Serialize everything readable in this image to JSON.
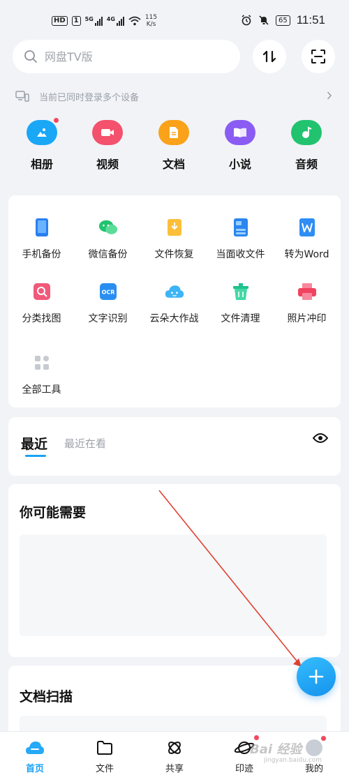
{
  "status_bar": {
    "hd": "HD",
    "sim1": "1",
    "net1": "5G",
    "net2": "4G",
    "speed_value": "115",
    "speed_unit": "K/s",
    "battery": "65",
    "time": "11:51"
  },
  "search": {
    "placeholder": "网盘TV版"
  },
  "notice": {
    "text": "当前已同时登录多个设备"
  },
  "categories": [
    {
      "label": "相册",
      "icon": "photo-album-icon",
      "color": "#1aa7f6"
    },
    {
      "label": "视频",
      "icon": "video-icon",
      "color": "#f4516c"
    },
    {
      "label": "文档",
      "icon": "document-icon",
      "color": "#f9a21a"
    },
    {
      "label": "小说",
      "icon": "book-icon",
      "color": "#8a5cf3"
    },
    {
      "label": "音频",
      "icon": "music-icon",
      "color": "#21c36f"
    }
  ],
  "tools": [
    {
      "label": "手机备份",
      "icon": "phone-backup-icon"
    },
    {
      "label": "微信备份",
      "icon": "wechat-backup-icon"
    },
    {
      "label": "文件恢复",
      "icon": "file-restore-icon"
    },
    {
      "label": "当面收文件",
      "icon": "receive-files-icon"
    },
    {
      "label": "转为Word",
      "icon": "word-convert-icon"
    },
    {
      "label": "分类找图",
      "icon": "find-image-icon"
    },
    {
      "label": "文字识别",
      "icon": "ocr-icon"
    },
    {
      "label": "云朵大作战",
      "icon": "cloud-game-icon"
    },
    {
      "label": "文件清理",
      "icon": "file-clean-icon"
    },
    {
      "label": "照片冲印",
      "icon": "photo-print-icon"
    },
    {
      "label": "全部工具",
      "icon": "all-tools-icon"
    }
  ],
  "ocr_badge": "OCR",
  "recent": {
    "tab_active": "最近",
    "tab_other": "最近在看"
  },
  "suggest": {
    "title": "你可能需要"
  },
  "scan": {
    "title": "文档扫描"
  },
  "nav": [
    {
      "label": "首页",
      "icon": "home-cloud-icon"
    },
    {
      "label": "文件",
      "icon": "folder-icon"
    },
    {
      "label": "共享",
      "icon": "share-icon"
    },
    {
      "label": "印迹",
      "icon": "planet-icon"
    },
    {
      "label": "我的",
      "icon": "avatar-icon"
    }
  ],
  "watermark": {
    "text": "Bai 经验",
    "sub": "jingyan.baidu.com"
  },
  "colors": {
    "accent": "#1aa2f5",
    "badge": "#f2495e",
    "annotation_arrow": "#e0412f"
  }
}
